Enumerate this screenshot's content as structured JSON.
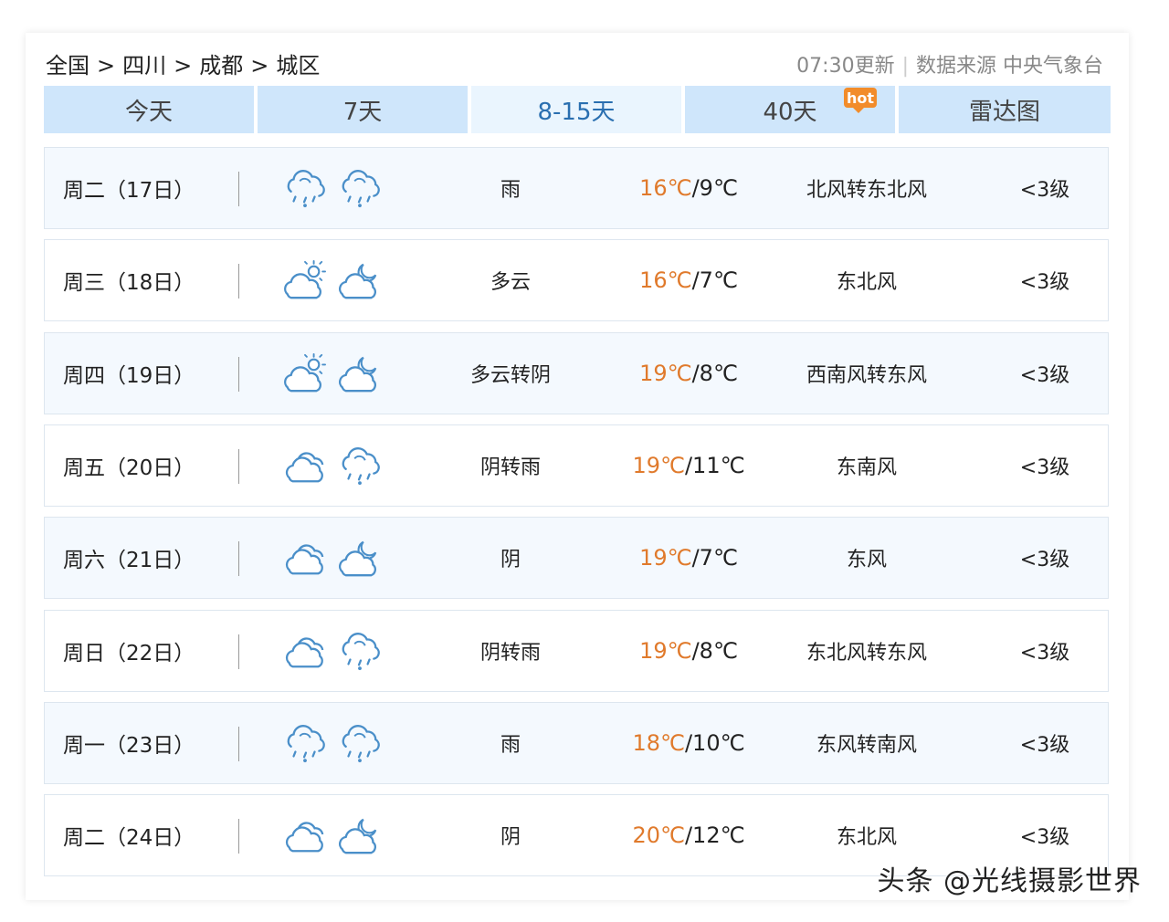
{
  "breadcrumb": [
    "全国",
    "四川",
    "成都",
    "城区"
  ],
  "breadcrumb_sep": ">",
  "meta": {
    "update": "07:30更新",
    "divider": "|",
    "source": "数据来源 中央气象台"
  },
  "tabs": [
    {
      "label": "今天"
    },
    {
      "label": "7天"
    },
    {
      "label": "8-15天"
    },
    {
      "label": "40天",
      "badge": "hot"
    },
    {
      "label": "雷达图"
    }
  ],
  "days": [
    {
      "date": "周二（17日）",
      "icon_day": "rain-icon",
      "icon_night": "rain-icon",
      "desc": "雨",
      "high": "16℃",
      "low": "9℃",
      "wind": "北风转东北风",
      "level": "<3级"
    },
    {
      "date": "周三（18日）",
      "icon_day": "partly-cloudy-day-icon",
      "icon_night": "cloudy-night-icon",
      "desc": "多云",
      "high": "16℃",
      "low": "7℃",
      "wind": "东北风",
      "level": "<3级"
    },
    {
      "date": "周四（19日）",
      "icon_day": "partly-cloudy-day-icon",
      "icon_night": "cloudy-night-icon",
      "desc": "多云转阴",
      "high": "19℃",
      "low": "8℃",
      "wind": "西南风转东风",
      "level": "<3级"
    },
    {
      "date": "周五（20日）",
      "icon_day": "overcast-icon",
      "icon_night": "rain-icon",
      "desc": "阴转雨",
      "high": "19℃",
      "low": "11℃",
      "wind": "东南风",
      "level": "<3级"
    },
    {
      "date": "周六（21日）",
      "icon_day": "overcast-icon",
      "icon_night": "cloudy-night-icon",
      "desc": "阴",
      "high": "19℃",
      "low": "7℃",
      "wind": "东风",
      "level": "<3级"
    },
    {
      "date": "周日（22日）",
      "icon_day": "overcast-icon",
      "icon_night": "rain-icon",
      "desc": "阴转雨",
      "high": "19℃",
      "low": "8℃",
      "wind": "东北风转东风",
      "level": "<3级"
    },
    {
      "date": "周一（23日）",
      "icon_day": "rain-icon",
      "icon_night": "rain-icon",
      "desc": "雨",
      "high": "18℃",
      "low": "10℃",
      "wind": "东风转南风",
      "level": "<3级"
    },
    {
      "date": "周二（24日）",
      "icon_day": "overcast-icon",
      "icon_night": "cloudy-night-icon",
      "desc": "阴",
      "high": "20℃",
      "low": "12℃",
      "wind": "东北风",
      "level": "<3级"
    }
  ],
  "colors": {
    "tab_bg": "#cfe6fb",
    "tab_active_bg": "#eaf5fe",
    "tab_active_text": "#2a6fb0",
    "high_temp": "#e07a2c",
    "icon_stroke": "#4a8fc9",
    "hot_badge": "#f28c2a"
  },
  "watermark": "头条 @光线摄影世界"
}
